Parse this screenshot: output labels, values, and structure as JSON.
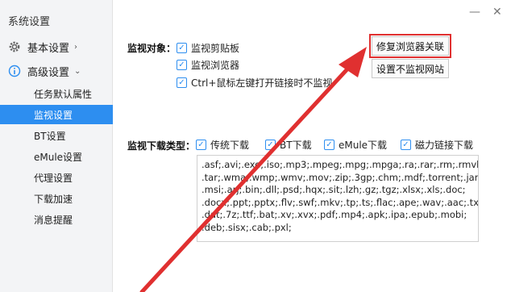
{
  "app": {
    "title": "系统设置"
  },
  "sidebar": {
    "groups": [
      {
        "label": "基本设置",
        "icon": "gear-icon"
      },
      {
        "label": "高级设置",
        "icon": "info-icon"
      }
    ],
    "items": [
      {
        "label": "任务默认属性"
      },
      {
        "label": "监视设置",
        "active": true
      },
      {
        "label": "BT设置"
      },
      {
        "label": "eMule设置"
      },
      {
        "label": "代理设置"
      },
      {
        "label": "下载加速"
      },
      {
        "label": "消息提醒"
      }
    ]
  },
  "window": {
    "minimize": "—",
    "close": "✕"
  },
  "monitor": {
    "label": "监视对象：",
    "options": [
      {
        "label": "监视剪贴板",
        "checked": true
      },
      {
        "label": "监视浏览器",
        "checked": true
      },
      {
        "label": "Ctrl+鼠标左键打开链接时不监视",
        "checked": true
      }
    ],
    "repair_button": "修复浏览器关联",
    "no_monitor_button": "设置不监视网站"
  },
  "download_types": {
    "label": "监视下载类型：",
    "options": [
      {
        "label": "传统下载",
        "checked": true
      },
      {
        "label": "BT下载",
        "checked": true
      },
      {
        "label": "eMule下载",
        "checked": true
      },
      {
        "label": "磁力链接下载",
        "checked": true
      }
    ],
    "extensions": ".asf;.avi;.exe;.iso;.mp3;.mpeg;.mpg;.mpga;.ra;.rar;.rm;.rmvb;\n.tar;.wma;.wmp;.wmv;.mov;.zip;.3gp;.chm;.mdf;.torrent;.jar;\n.msi;.arj;.bin;.dll;.psd;.hqx;.sit;.lzh;.gz;.tgz;.xlsx;.xls;.doc;\n.docx;.ppt;.pptx;.flv;.swf;.mkv;.tp;.ts;.flac;.ape;.wav;.aac;.txt;\n.dat;.7z;.ttf;.bat;.xv;.xvx;.pdf;.mp4;.apk;.ipa;.epub;.mobi;\n.deb;.sisx;.cab;.pxl;"
  },
  "colors": {
    "accent": "#2d8ef0",
    "annotation": "#e03030"
  }
}
